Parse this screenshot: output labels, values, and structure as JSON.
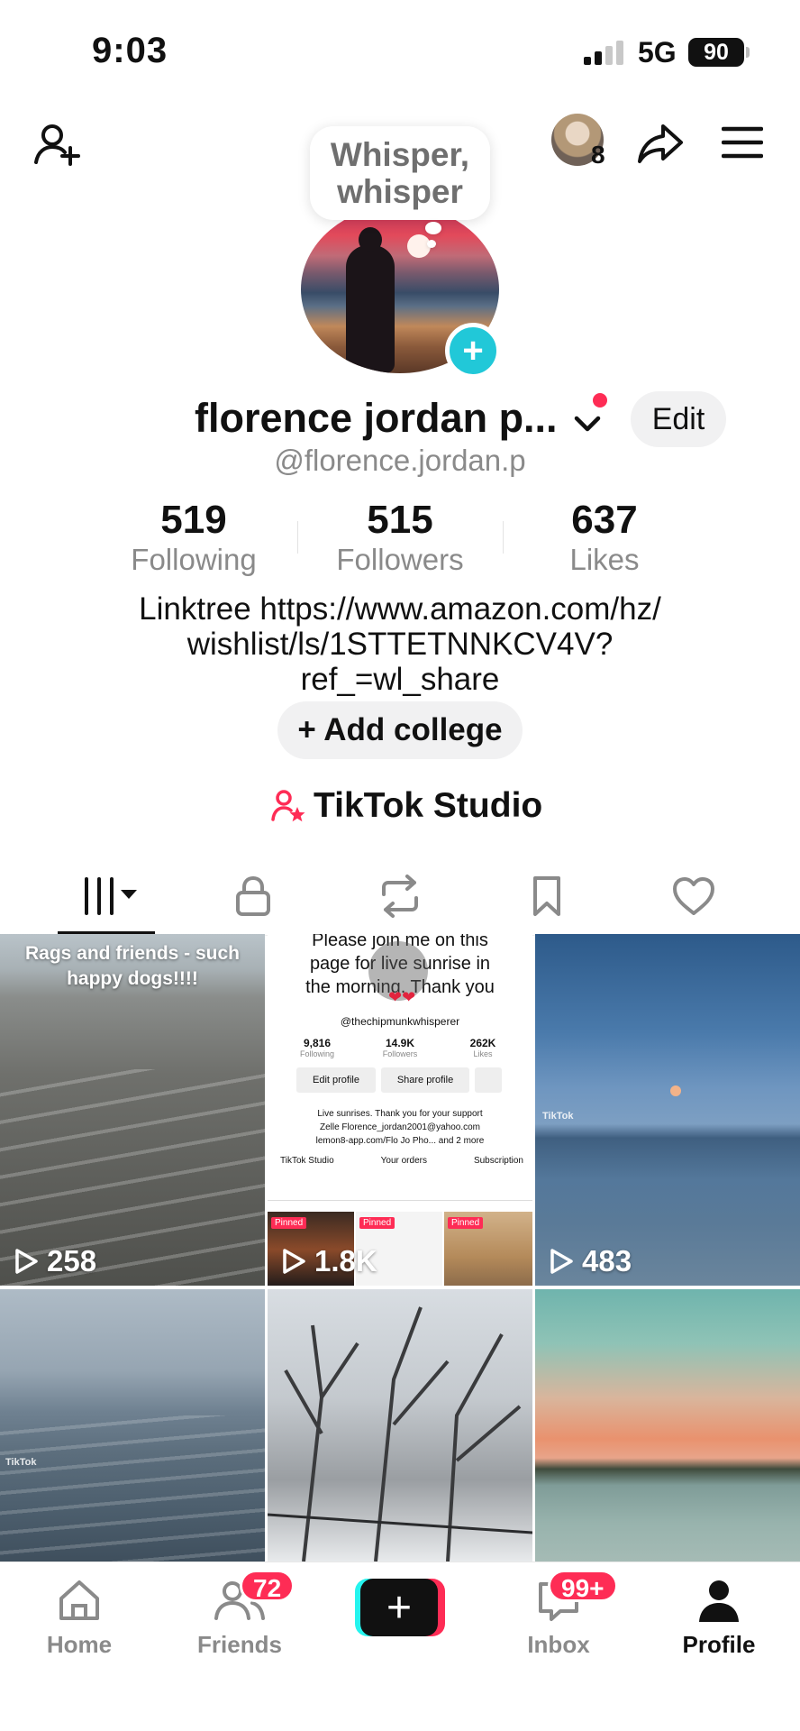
{
  "status_bar": {
    "time": "9:03",
    "network": "5G",
    "battery": "90"
  },
  "top_bar": {
    "friend_count": "8",
    "bubble_text": "Whisper, whisper"
  },
  "profile": {
    "display_name": "florence jordan p...",
    "edit_label": "Edit",
    "handle": "@florence.jordan.p",
    "stats": [
      {
        "value": "519",
        "label": "Following"
      },
      {
        "value": "515",
        "label": "Followers"
      },
      {
        "value": "637",
        "label": "Likes"
      }
    ],
    "bio_line1": "Linktree https://www.amazon.com/hz/",
    "bio_line2": "wishlist/ls/1STTETNNKCV4V?",
    "bio_line3": "ref_=wl_share",
    "college_label": "+ Add college",
    "studio_label": "TikTok Studio"
  },
  "tabs": [
    "videos-tab",
    "private-tab",
    "reposts-tab",
    "favorites-tab",
    "liked-tab"
  ],
  "videos": [
    {
      "caption": "Rags and friends - such happy dogs!!!!",
      "views": "258"
    },
    {
      "caption_lines": [
        "Please join me on this",
        "page for live sunrise in",
        "the morning. Thank you"
      ],
      "mini_handle": "@thechipmunkwhisperer",
      "mini_stats": [
        {
          "value": "9,816",
          "label": "Following"
        },
        {
          "value": "14.9K",
          "label": "Followers"
        },
        {
          "value": "262K",
          "label": "Likes"
        }
      ],
      "mini_edit": "Edit profile",
      "mini_share": "Share profile",
      "mini_bio_line1": "Live sunrises.  Thank you for your support",
      "mini_bio_line2": "Zelle Florence_jordan2001@yahoo.com",
      "mini_bio_line3": "lemon8-app.com/Flo Jo Pho... and 2 more",
      "mini_studio": "TikTok Studio",
      "mini_orders": "Your orders",
      "mini_subscription": "Subscription",
      "pinned": "Pinned",
      "views": "1.8K"
    },
    {
      "watermark": "TikTok",
      "views": "483"
    },
    {
      "watermark": "TikTok"
    },
    {},
    {}
  ],
  "bottom_nav": {
    "home": "Home",
    "friends": "Friends",
    "friends_badge": "72",
    "inbox": "Inbox",
    "inbox_badge": "99+",
    "profile": "Profile"
  },
  "colors": {
    "accent_red": "#fe2c55",
    "accent_cyan": "#25f4ee",
    "avatar_add": "#21c8d8"
  }
}
